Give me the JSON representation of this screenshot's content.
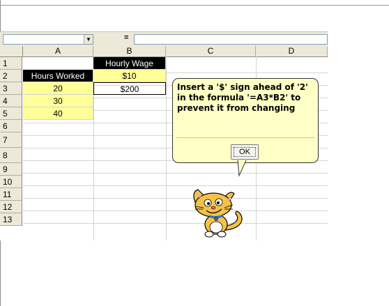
{
  "formula_bar": {
    "dropdown_glyph": "▼",
    "fx_label": "="
  },
  "columns": [
    "A",
    "B",
    "C",
    "D"
  ],
  "rows": [
    "1",
    "2",
    "3",
    "4",
    "5",
    "6",
    "7",
    "8",
    "9",
    "10",
    "11",
    "12",
    "13"
  ],
  "cells": {
    "B1": "Hourly Wage",
    "A2": "Hours Worked",
    "B2": "$10",
    "A3": "20",
    "B3": "$200",
    "A4": "30",
    "A5": "40"
  },
  "assistant": {
    "message": "Insert a '$' sign ahead of '2' in the formula '=A3*B2' to prevent it from changing",
    "ok_label": "OK"
  },
  "colors": {
    "header_fill": "#000000",
    "input_fill": "#ffff99",
    "bubble_fill": "#ffffc6"
  }
}
